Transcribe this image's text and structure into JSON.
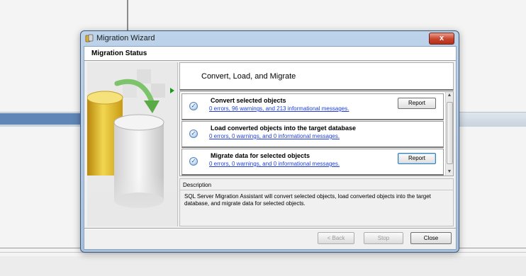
{
  "window": {
    "title": "Migration Wizard",
    "close_glyph": "x",
    "header": "Migration Status"
  },
  "step": {
    "title": "Convert, Load, and Migrate"
  },
  "tasks": [
    {
      "title": "Convert selected objects",
      "summary": "0 errors, 96 warnings, and 213 informational messages.",
      "report_label": "Report",
      "status_icon": "check-circle-icon"
    },
    {
      "title": "Load converted objects into the target database",
      "summary": "0 errors, 0 warnings, and 0 informational messages.",
      "status_icon": "check-circle-icon"
    },
    {
      "title": "Migrate data for selected objects",
      "summary": "0 errors, 0 warnings, and 0 informational messages.",
      "report_label": "Report",
      "status_icon": "check-circle-icon"
    }
  ],
  "description": {
    "label": "Description",
    "text": "SQL Server Migration Assistant will convert selected objects, load converted objects into the target database, and migrate data for selected objects."
  },
  "buttons": {
    "back": "< Back",
    "stop": "Stop",
    "close": "Close"
  },
  "colors": {
    "link": "#1f3fdb",
    "arrow_green": "#1a9a1a",
    "titlebar": "#bcd3ea",
    "close_red": "#c8432c"
  }
}
